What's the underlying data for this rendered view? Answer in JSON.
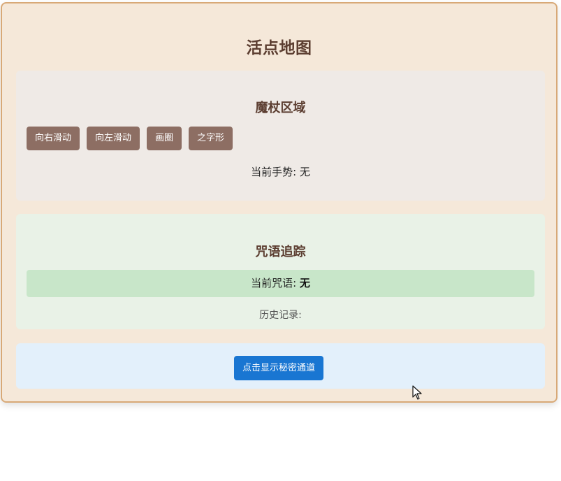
{
  "page": {
    "title": "活点地图"
  },
  "wand_zone": {
    "title": "魔杖区域",
    "buttons": [
      {
        "label": "向右滑动"
      },
      {
        "label": "向左滑动"
      },
      {
        "label": "画圈"
      },
      {
        "label": "之字形"
      }
    ],
    "status_label": "当前手势:",
    "status_value": "无"
  },
  "spell_zone": {
    "title": "咒语追踪",
    "current_label": "当前咒语:",
    "current_value": "无",
    "history_label": "历史记录:"
  },
  "secret_zone": {
    "button_label": "点击显示秘密通道"
  },
  "icons": {
    "cursor": "mouse-pointer-icon"
  },
  "colors": {
    "card_background": "#f5e8d9",
    "card_border": "#d8a977",
    "heading": "#5c3e31",
    "gesture_button": "#8d6e63",
    "spell_highlight": "#c8e6c9",
    "secret_button": "#1976d2"
  }
}
